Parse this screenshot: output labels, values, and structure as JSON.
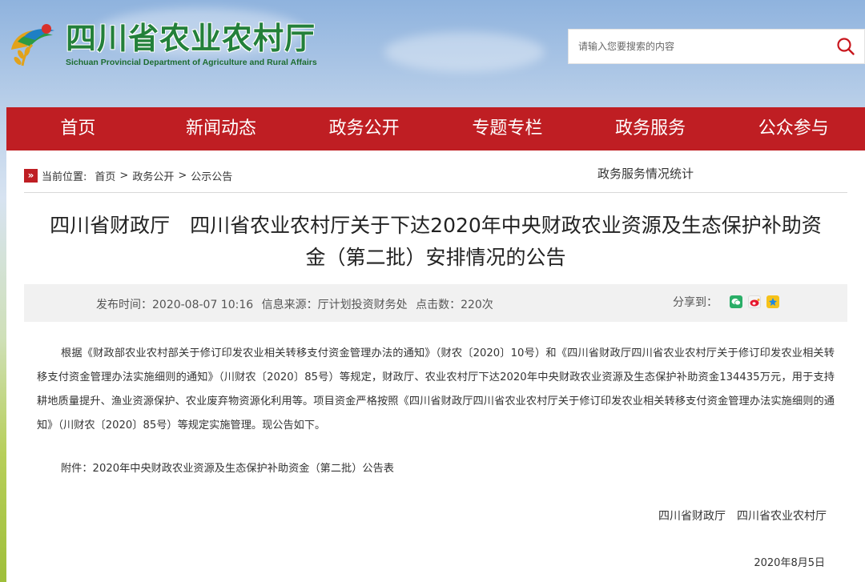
{
  "header": {
    "site_name_cn": "四川省农业农村厅",
    "site_name_en": "Sichuan Provincial Department of Agriculture and Rural Affairs",
    "search_placeholder": "请输入您要搜索的内容",
    "logo_icon": "grain-bird-logo",
    "search_icon": "search-icon"
  },
  "nav": {
    "items": [
      "首页",
      "新闻动态",
      "政务公开",
      "专题专栏",
      "政务服务",
      "公众参与"
    ]
  },
  "breadcrumb": {
    "icon": "»",
    "label": "当前位置:",
    "items": [
      "首页",
      "政务公开",
      "公示公告"
    ],
    "separator": ">"
  },
  "side_link": "政务服务情况统计",
  "article": {
    "title_line1": "四川省财政厅　四川省农业农村厅关于下达2020年中央财政农业资源及生态保护补助资",
    "title_line2": "金（第二批）安排情况的公告",
    "publish_time": "发布时间：2020-08-07 10:16",
    "source": "信息来源：厅计划投资财务处",
    "clicks": "点击数：220次",
    "share_label": "分享到：",
    "share_icons": [
      "wechat-icon",
      "weibo-icon",
      "qzone-icon"
    ],
    "body": "根据《财政部农业农村部关于修订印发农业相关转移支付资金管理办法的通知》（财农〔2020〕10号）和《四川省财政厅四川省农业农村厅关于修订印发农业相关转移支付资金管理办法实施细则的通知》（川财农〔2020〕85号）等规定，财政厅、农业农村厅下达2020年中央财政农业资源及生态保护补助资金134435万元，用于支持耕地质量提升、渔业资源保护、农业废弃物资源化利用等。项目资金严格按照《四川省财政厅四川省农业农村厅关于修订印发农业相关转移支付资金管理办法实施细则的通知》（川财农〔2020〕85号）等规定实施管理。现公告如下。",
    "attachment": "附件：2020年中央财政农业资源及生态保护补助资金（第二批）公告表",
    "signature": "四川省财政厅　四川省农业农村厅",
    "date": "2020年8月5日"
  },
  "colors": {
    "nav_red": "#bf1e23",
    "logo_green": "#23803a"
  }
}
